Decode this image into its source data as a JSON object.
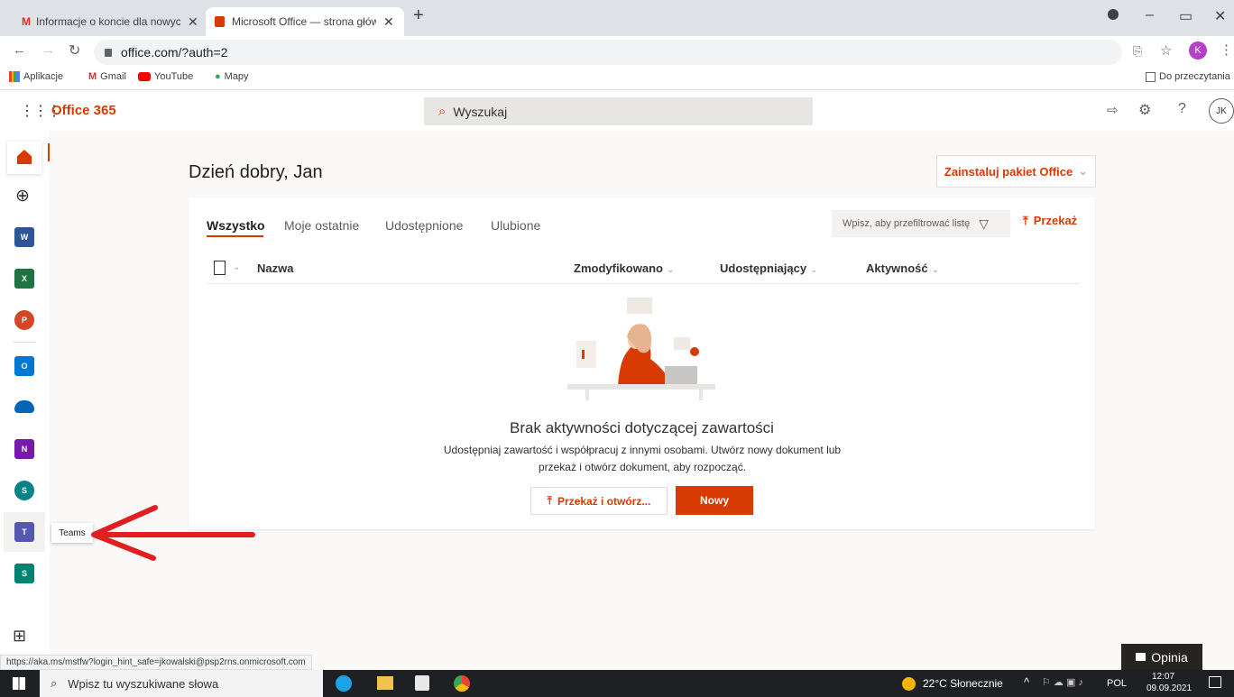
{
  "browser": {
    "tabs": [
      {
        "title": "Informacje o koncie dla nowych",
        "active": false
      },
      {
        "title": "Microsoft Office — strona główn",
        "active": true
      }
    ],
    "url": "office.com/?auth=2",
    "bookmarks": [
      "Aplikacje",
      "Gmail",
      "YouTube",
      "Mapy"
    ],
    "reading_list": "Do przeczytania",
    "profile_initial": "K",
    "status_url": "https://aka.ms/mstfw?login_hint_safe=jkowalski@psp2rns.onmicrosoft.com"
  },
  "office": {
    "brand": "Office 365",
    "search_placeholder": "Wyszukaj",
    "user_initials": "JK",
    "help": "?",
    "greeting": "Dzień dobry, Jan",
    "install_label": "Zainstaluj pakiet Office",
    "tabs": [
      "Wszystko",
      "Moje ostatnie",
      "Udostępnione",
      "Ulubione"
    ],
    "filter_placeholder": "Wpisz, aby przefiltrować listę",
    "upload_label": "Przekaż",
    "columns": [
      "Nazwa",
      "Zmodyfikowano",
      "Udostępniający",
      "Aktywność"
    ],
    "empty_title": "Brak aktywności dotyczącej zawartości",
    "empty_desc": "Udostępniaj zawartość i współpracuj z innymi osobami. Utwórz nowy dokument lub przekaż i otwórz dokument, aby rozpocząć.",
    "upload_open_label": "Przekaż i otwórz...",
    "new_label": "Nowy",
    "tooltip": "Teams",
    "feedback": "Opinia",
    "apps": [
      {
        "icon": "word-icon",
        "letter": "W",
        "color": "#2b579a"
      },
      {
        "icon": "excel-icon",
        "letter": "X",
        "color": "#217346"
      },
      {
        "icon": "powerpoint-icon",
        "letter": "P",
        "color": "#d24726"
      },
      {
        "icon": "outlook-icon",
        "letter": "O",
        "color": "#0078d4"
      },
      {
        "icon": "onedrive-icon",
        "letter": "",
        "color": "#0364b8"
      },
      {
        "icon": "onenote-icon",
        "letter": "N",
        "color": "#7719aa"
      },
      {
        "icon": "sharepoint-icon",
        "letter": "S",
        "color": "#038387"
      },
      {
        "icon": "teams-icon",
        "letter": "T",
        "color": "#5558af"
      },
      {
        "icon": "sway-icon",
        "letter": "S",
        "color": "#008272"
      }
    ]
  },
  "taskbar": {
    "search_placeholder": "Wpisz tu wyszukiwane słowa",
    "weather": "22°C Słonecznie",
    "lang": "POL",
    "time": "12:07",
    "date": "09.09.2021"
  },
  "colors": {
    "accent": "#d83b01",
    "annotation_arrow": "#e02020"
  }
}
